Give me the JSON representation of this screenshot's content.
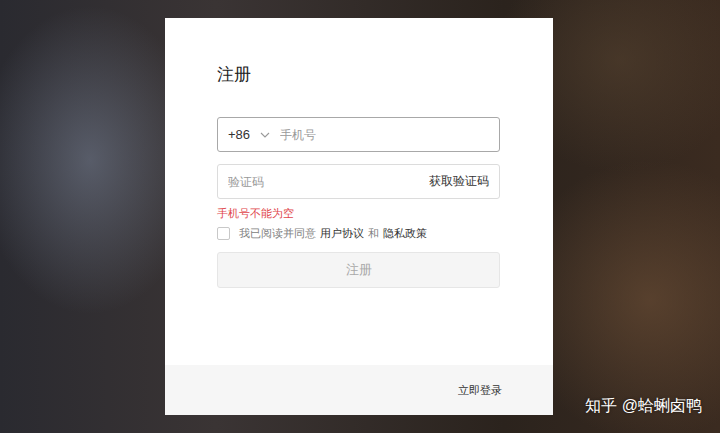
{
  "register": {
    "title": "注册",
    "phone": {
      "country_code": "+86",
      "placeholder": "手机号"
    },
    "code": {
      "placeholder": "验证码",
      "button": "获取验证码"
    },
    "error": "手机号不能为空",
    "agreement": {
      "checked": false,
      "prefix": "我已阅读并同意",
      "terms": "用户协议",
      "and": "和",
      "privacy": "隐私政策"
    },
    "submit": {
      "label": "注册",
      "disabled": true
    }
  },
  "footer": {
    "login_link": "立即登录"
  },
  "watermark": "知乎 @蛤蜊卤鸭"
}
